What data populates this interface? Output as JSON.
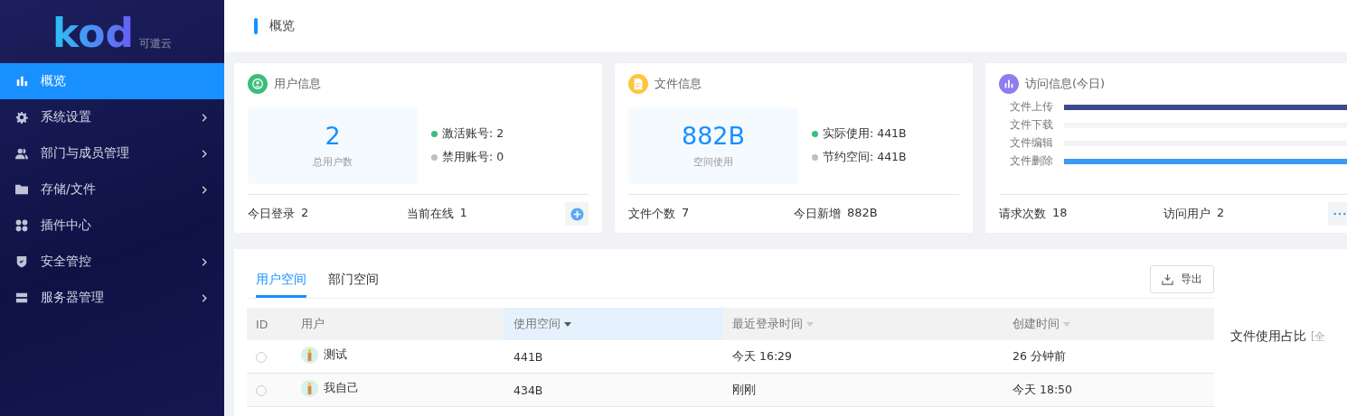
{
  "logo": {
    "text": "kod",
    "subtitle": "可道云"
  },
  "sidebar": {
    "items": [
      {
        "label": "概览",
        "selected": true,
        "has_children": false
      },
      {
        "label": "系统设置",
        "selected": false,
        "has_children": true
      },
      {
        "label": "部门与成员管理",
        "selected": false,
        "has_children": true
      },
      {
        "label": "存储/文件",
        "selected": false,
        "has_children": true
      },
      {
        "label": "插件中心",
        "selected": false,
        "has_children": false
      },
      {
        "label": "安全管控",
        "selected": false,
        "has_children": true
      },
      {
        "label": "服务器管理",
        "selected": false,
        "has_children": true
      }
    ]
  },
  "header": {
    "title": "概览"
  },
  "cards": [
    {
      "kind": "summary",
      "color": "#3dbd7d",
      "title": "用户信息",
      "big": "2",
      "big_label": "总用户数",
      "legend": [
        {
          "label": "激活账号: 2",
          "color": "#3dbd7d"
        },
        {
          "label": "禁用账号: 0",
          "color": "#bfbfbf"
        }
      ],
      "footer": [
        {
          "label": "今日登录",
          "value": "2"
        },
        {
          "label": "当前在线",
          "value": "1"
        }
      ]
    },
    {
      "kind": "summary",
      "color": "#ffc53d",
      "title": "文件信息",
      "big": "882B",
      "big_label": "空间使用",
      "legend": [
        {
          "label": "实际使用: 441B",
          "color": "#3dbd7d"
        },
        {
          "label": "节约空间: 441B",
          "color": "#bfbfbf"
        }
      ],
      "footer": [
        {
          "label": "文件个数",
          "value": "7"
        },
        {
          "label": "今日新增",
          "value": "882B"
        }
      ]
    },
    {
      "kind": "bars",
      "color": "#8e7cf0",
      "title": "访问信息(今日)",
      "bars": [
        {
          "label": "文件上传",
          "level": 1,
          "color": "#3d4a8a"
        },
        {
          "label": "文件下载",
          "level": 0
        },
        {
          "label": "文件编辑",
          "level": 0
        },
        {
          "label": "文件删除",
          "level": 1,
          "color": "#3a9bf5"
        }
      ],
      "footer": [
        {
          "label": "请求次数",
          "value": "18"
        },
        {
          "label": "访问用户",
          "value": "2"
        }
      ]
    }
  ],
  "tabs": [
    {
      "label": "用户空间",
      "selected": true
    },
    {
      "label": "部门空间",
      "selected": false
    }
  ],
  "export_button": "导出",
  "table": {
    "columns": [
      {
        "label": "ID",
        "sortable": false,
        "sorted": false
      },
      {
        "label": "用户",
        "sortable": false,
        "sorted": false
      },
      {
        "label": "使用空间",
        "sortable": true,
        "sorted": true
      },
      {
        "label": "最近登录时间",
        "sortable": true,
        "sorted": false
      },
      {
        "label": "创建时间",
        "sortable": true,
        "sorted": false
      }
    ],
    "rows": [
      {
        "selected": false,
        "user": "测试",
        "space": "441B",
        "last_login": "今天 16:29",
        "created": "26 分钟前"
      },
      {
        "selected": false,
        "user": "我自己",
        "space": "434B",
        "last_login": "刚刚",
        "created": "今天 18:50"
      }
    ]
  },
  "side_panel": {
    "title": "文件使用占比",
    "filter": "[全"
  }
}
